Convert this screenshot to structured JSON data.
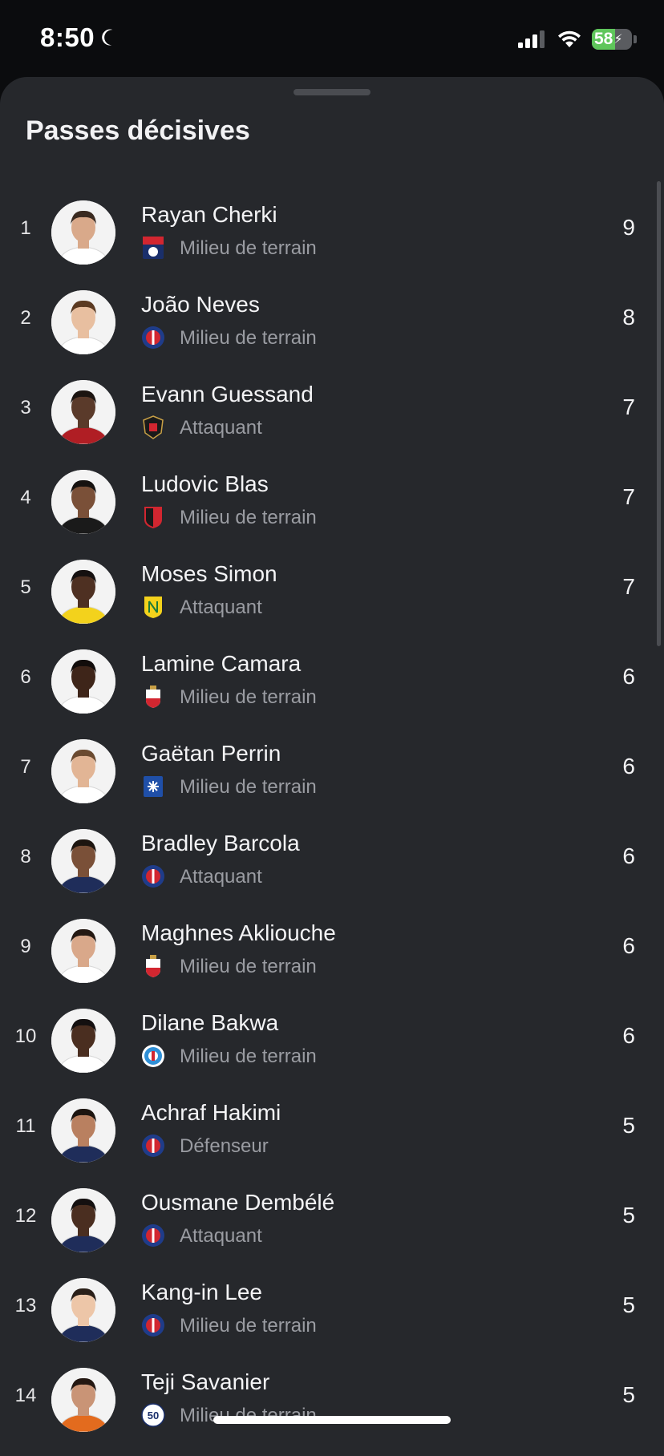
{
  "status_bar": {
    "time": "8:50",
    "battery_level": "58",
    "battery_percent": 58,
    "charging": true,
    "focus_icon": "moon-icon",
    "signal_icon": "cellular-signal-icon",
    "wifi_icon": "wifi-icon"
  },
  "sheet": {
    "title": "Passes décisives"
  },
  "colors": {
    "background": "#26282c",
    "secondary_text": "#9a9ca2",
    "battery_green": "#5fc65b"
  },
  "players": [
    {
      "rank": "1",
      "name": "Rayan Cherki",
      "position": "Milieu de terrain",
      "value": "9",
      "club_icon": "lyon-badge-icon",
      "skin": "#d9a98a",
      "hair": "#3a2a20",
      "shirt": "#ffffff"
    },
    {
      "rank": "2",
      "name": "João Neves",
      "position": "Milieu de terrain",
      "value": "8",
      "club_icon": "psg-badge-icon",
      "skin": "#e8bfa0",
      "hair": "#5b3a22",
      "shirt": "#ffffff"
    },
    {
      "rank": "3",
      "name": "Evann Guessand",
      "position": "Attaquant",
      "value": "7",
      "club_icon": "nice-badge-icon",
      "skin": "#5a3a2a",
      "hair": "#1b1410",
      "shirt": "#b01e24"
    },
    {
      "rank": "4",
      "name": "Ludovic Blas",
      "position": "Milieu de terrain",
      "value": "7",
      "club_icon": "rennes-badge-icon",
      "skin": "#7a5038",
      "hair": "#161210",
      "shirt": "#1a1a1a"
    },
    {
      "rank": "5",
      "name": "Moses Simon",
      "position": "Attaquant",
      "value": "7",
      "club_icon": "nantes-badge-icon",
      "skin": "#4e3022",
      "hair": "#151010",
      "shirt": "#f3d21c"
    },
    {
      "rank": "6",
      "name": "Lamine Camara",
      "position": "Milieu de terrain",
      "value": "6",
      "club_icon": "monaco-badge-icon",
      "skin": "#3e2519",
      "hair": "#120d0b",
      "shirt": "#ffffff"
    },
    {
      "rank": "7",
      "name": "Gaëtan Perrin",
      "position": "Milieu de terrain",
      "value": "6",
      "club_icon": "auxerre-badge-icon",
      "skin": "#e2b595",
      "hair": "#6a4a30",
      "shirt": "#ffffff"
    },
    {
      "rank": "8",
      "name": "Bradley Barcola",
      "position": "Attaquant",
      "value": "6",
      "club_icon": "psg-badge-icon",
      "skin": "#7a5038",
      "hair": "#1d1510",
      "shirt": "#1f2d5a"
    },
    {
      "rank": "9",
      "name": "Maghnes Akliouche",
      "position": "Milieu de terrain",
      "value": "6",
      "club_icon": "monaco-badge-icon",
      "skin": "#d9a88a",
      "hair": "#241812",
      "shirt": "#ffffff"
    },
    {
      "rank": "10",
      "name": "Dilane Bakwa",
      "position": "Milieu de terrain",
      "value": "6",
      "club_icon": "strasbourg-badge-icon",
      "skin": "#4a2e20",
      "hair": "#141010",
      "shirt": "#ffffff"
    },
    {
      "rank": "11",
      "name": "Achraf Hakimi",
      "position": "Défenseur",
      "value": "5",
      "club_icon": "psg-badge-icon",
      "skin": "#b98060",
      "hair": "#1d1510",
      "shirt": "#1f2d5a"
    },
    {
      "rank": "12",
      "name": "Ousmane Dembélé",
      "position": "Attaquant",
      "value": "5",
      "club_icon": "psg-badge-icon",
      "skin": "#4a2e20",
      "hair": "#141010",
      "shirt": "#1f2d5a"
    },
    {
      "rank": "13",
      "name": "Kang-in Lee",
      "position": "Milieu de terrain",
      "value": "5",
      "club_icon": "psg-badge-icon",
      "skin": "#edc6a8",
      "hair": "#2a1f18",
      "shirt": "#1f2d5a"
    },
    {
      "rank": "14",
      "name": "Teji Savanier",
      "position": "Milieu de terrain",
      "value": "5",
      "club_icon": "montpellier-badge-icon",
      "skin": "#c99476",
      "hair": "#241812",
      "shirt": "#e36b1e"
    }
  ]
}
